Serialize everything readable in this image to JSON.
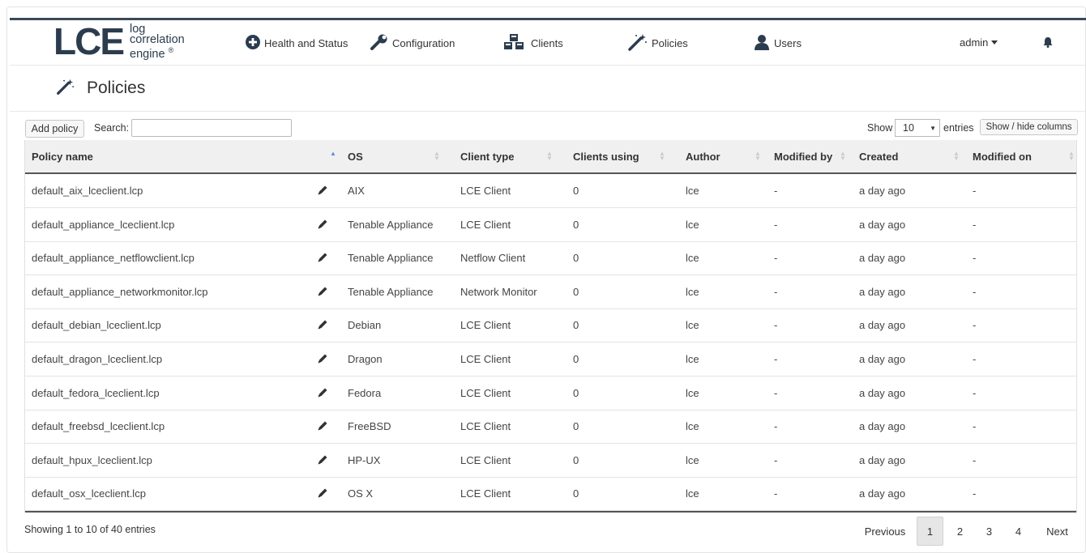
{
  "logo": {
    "mark": "LCE",
    "line1": "log",
    "line2": "correlation",
    "line3": "engine",
    "reg": "®"
  },
  "nav": {
    "health": "Health and Status",
    "configuration": "Configuration",
    "clients": "Clients",
    "policies": "Policies",
    "users": "Users",
    "user_menu": "admin"
  },
  "page": {
    "title": "Policies"
  },
  "controls": {
    "add_policy": "Add policy",
    "search_label": "Search:",
    "search_value": "",
    "show_label": "Show",
    "entries_value": "10",
    "entries_label": "entries",
    "show_hide": "Show / hide columns"
  },
  "table": {
    "columns": [
      "Policy name",
      "OS",
      "Client type",
      "Clients using",
      "Author",
      "Modified by",
      "Created",
      "Modified on"
    ],
    "sorted_column": "Policy name",
    "rows": [
      [
        "default_aix_lceclient.lcp",
        "AIX",
        "LCE Client",
        "0",
        "lce",
        "-",
        "a day ago",
        "-"
      ],
      [
        "default_appliance_lceclient.lcp",
        "Tenable Appliance",
        "LCE Client",
        "0",
        "lce",
        "-",
        "a day ago",
        "-"
      ],
      [
        "default_appliance_netflowclient.lcp",
        "Tenable Appliance",
        "Netflow Client",
        "0",
        "lce",
        "-",
        "a day ago",
        "-"
      ],
      [
        "default_appliance_networkmonitor.lcp",
        "Tenable Appliance",
        "Network Monitor",
        "0",
        "lce",
        "-",
        "a day ago",
        "-"
      ],
      [
        "default_debian_lceclient.lcp",
        "Debian",
        "LCE Client",
        "0",
        "lce",
        "-",
        "a day ago",
        "-"
      ],
      [
        "default_dragon_lceclient.lcp",
        "Dragon",
        "LCE Client",
        "0",
        "lce",
        "-",
        "a day ago",
        "-"
      ],
      [
        "default_fedora_lceclient.lcp",
        "Fedora",
        "LCE Client",
        "0",
        "lce",
        "-",
        "a day ago",
        "-"
      ],
      [
        "default_freebsd_lceclient.lcp",
        "FreeBSD",
        "LCE Client",
        "0",
        "lce",
        "-",
        "a day ago",
        "-"
      ],
      [
        "default_hpux_lceclient.lcp",
        "HP-UX",
        "LCE Client",
        "0",
        "lce",
        "-",
        "a day ago",
        "-"
      ],
      [
        "default_osx_lceclient.lcp",
        "OS X",
        "LCE Client",
        "0",
        "lce",
        "-",
        "a day ago",
        "-"
      ]
    ]
  },
  "footer": {
    "info": "Showing 1 to 10 of 40 entries",
    "previous": "Previous",
    "pages": [
      "1",
      "2",
      "3",
      "4"
    ],
    "current_page": "1",
    "next": "Next"
  },
  "colors": {
    "accent": "#2b3c4e",
    "sort_active": "#5b8fd8",
    "header_bg": "#f0f0f0"
  }
}
